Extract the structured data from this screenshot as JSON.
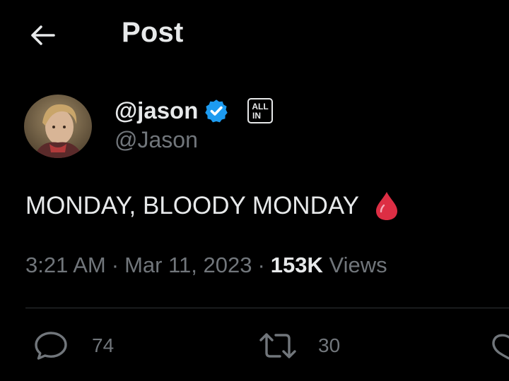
{
  "header": {
    "title": "Post",
    "back_icon": "arrow-left-icon"
  },
  "author": {
    "display_name": "@jason",
    "handle": "@Jason",
    "verified_icon": "verified-badge-icon",
    "verified_color": "#1d9bf0",
    "affiliation_badge_text": "ALL IN"
  },
  "tweet": {
    "text": "MONDAY, BLOODY MONDAY",
    "emoji_icon": "drop-of-blood-icon",
    "emoji_color": "#dd2e44"
  },
  "meta": {
    "time": "3:21 AM",
    "date": "Mar 11, 2023",
    "separator": "·",
    "views_count": "153K",
    "views_label": "Views"
  },
  "actions": {
    "reply_icon": "reply-bubble-icon",
    "reply_count": "74",
    "retweet_icon": "retweet-icon",
    "retweet_count": "30",
    "like_icon": "heart-icon"
  },
  "colors": {
    "background": "#000000",
    "primary_text": "#e7e9ea",
    "secondary_text": "#71767b",
    "divider": "#2f3336"
  }
}
